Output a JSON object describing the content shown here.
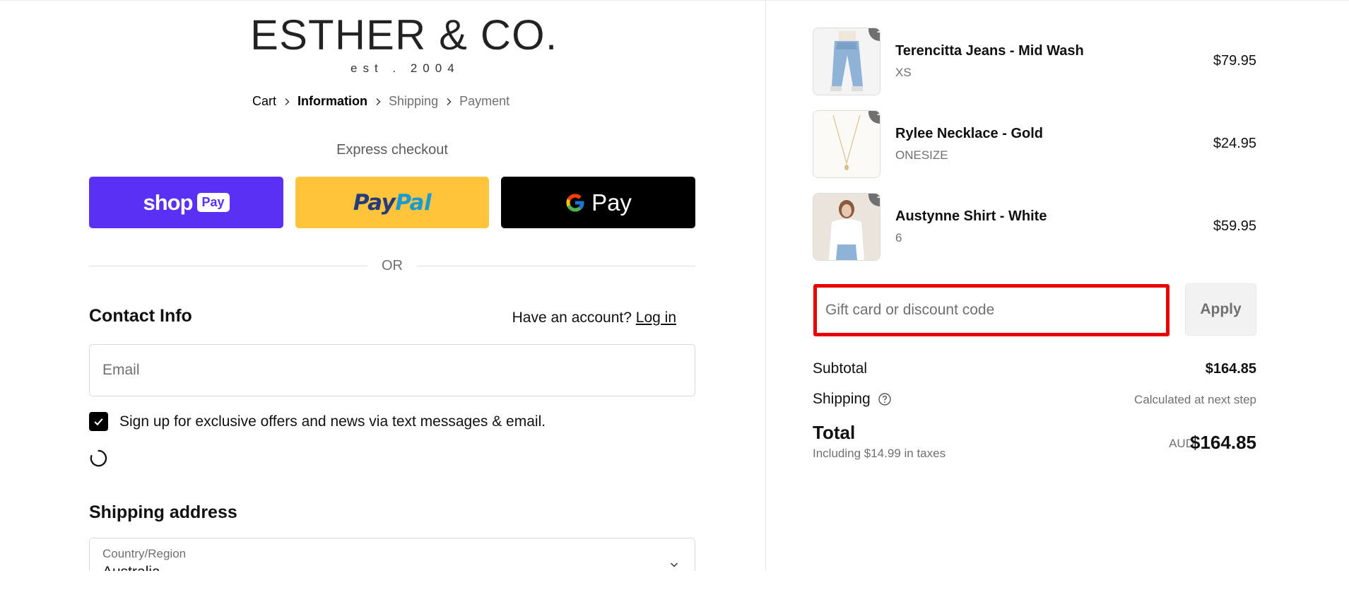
{
  "brand": {
    "name": "ESTHER & CO.",
    "tagline": "est . 2004"
  },
  "breadcrumb": [
    "Cart",
    "Information",
    "Shipping",
    "Payment"
  ],
  "express_checkout": {
    "label": "Express checkout",
    "shop_pay": {
      "word": "shop",
      "badge": "Pay"
    },
    "paypal": {
      "part1": "Pay",
      "part2": "Pal"
    },
    "gpay": {
      "word": "Pay"
    }
  },
  "divider_text": "OR",
  "contact": {
    "title": "Contact Info",
    "account_prompt": "Have an account?",
    "login_label": "Log in",
    "email_placeholder": "Email",
    "offers_checkbox_checked": true,
    "offers_label": "Sign up for exclusive offers and news via text messages & email."
  },
  "shipping_address": {
    "title": "Shipping address",
    "country_label": "Country/Region",
    "country_value": "Australia"
  },
  "order": {
    "items": [
      {
        "name": "Terencitta Jeans - Mid Wash",
        "variant": "XS",
        "quantity": "1",
        "price": "$79.95",
        "thumb": "jeans-photo"
      },
      {
        "name": "Rylee Necklace - Gold",
        "variant": "ONESIZE",
        "quantity": "1",
        "price": "$24.95",
        "thumb": "necklace-photo"
      },
      {
        "name": "Austynne Shirt - White",
        "variant": "6",
        "quantity": "1",
        "price": "$59.95",
        "thumb": "shirt-photo"
      }
    ],
    "discount_placeholder": "Gift card or discount code",
    "apply_label": "Apply",
    "subtotal_label": "Subtotal",
    "subtotal_value": "$164.85",
    "shipping_label": "Shipping",
    "shipping_value": "Calculated at next step",
    "total_label": "Total",
    "tax_note": "Including $14.99 in taxes",
    "currency": "AUD",
    "total_value": "$164.85"
  },
  "colors": {
    "shop_pay": "#5a31f4",
    "paypal": "#ffc439",
    "gpay": "#000000",
    "highlight": "#e60000",
    "muted_text": "#707070"
  },
  "icons": [
    "chevron-right-icon",
    "check-icon",
    "loading-spinner-icon",
    "chevron-down-icon",
    "help-circle-icon",
    "google-g-icon"
  ]
}
